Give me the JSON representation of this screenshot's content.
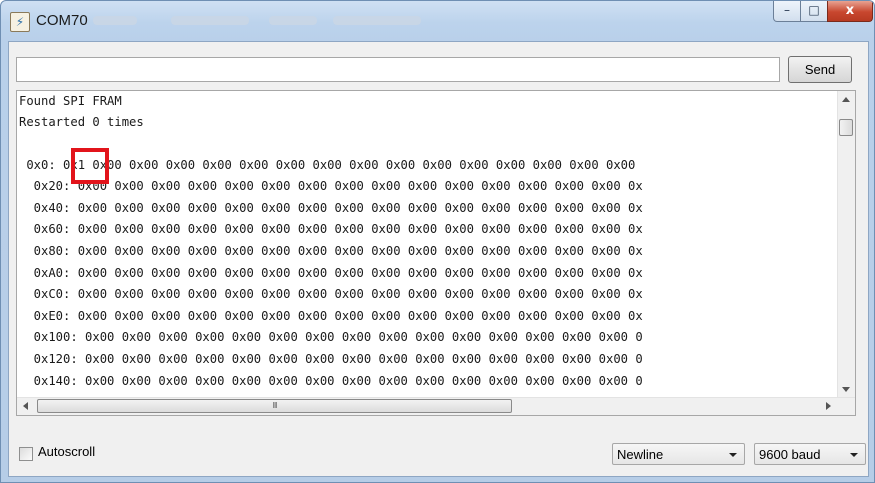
{
  "window": {
    "title": "COM70",
    "close_glyph": "x",
    "min_glyph": "–",
    "max_glyph": "□"
  },
  "toolbar": {
    "send_label": "Send",
    "input_value": ""
  },
  "output": {
    "lines": [
      "Found SPI FRAM",
      "Restarted 0 times",
      "",
      " 0x0: 0x1 0x00 0x00 0x00 0x00 0x00 0x00 0x00 0x00 0x00 0x00 0x00 0x00 0x00 0x00 0x00",
      "  0x20: 0x00 0x00 0x00 0x00 0x00 0x00 0x00 0x00 0x00 0x00 0x00 0x00 0x00 0x00 0x00 0x",
      "  0x40: 0x00 0x00 0x00 0x00 0x00 0x00 0x00 0x00 0x00 0x00 0x00 0x00 0x00 0x00 0x00 0x",
      "  0x60: 0x00 0x00 0x00 0x00 0x00 0x00 0x00 0x00 0x00 0x00 0x00 0x00 0x00 0x00 0x00 0x",
      "  0x80: 0x00 0x00 0x00 0x00 0x00 0x00 0x00 0x00 0x00 0x00 0x00 0x00 0x00 0x00 0x00 0x",
      "  0xA0: 0x00 0x00 0x00 0x00 0x00 0x00 0x00 0x00 0x00 0x00 0x00 0x00 0x00 0x00 0x00 0x",
      "  0xC0: 0x00 0x00 0x00 0x00 0x00 0x00 0x00 0x00 0x00 0x00 0x00 0x00 0x00 0x00 0x00 0x",
      "  0xE0: 0x00 0x00 0x00 0x00 0x00 0x00 0x00 0x00 0x00 0x00 0x00 0x00 0x00 0x00 0x00 0x",
      "  0x100: 0x00 0x00 0x00 0x00 0x00 0x00 0x00 0x00 0x00 0x00 0x00 0x00 0x00 0x00 0x00 0",
      "  0x120: 0x00 0x00 0x00 0x00 0x00 0x00 0x00 0x00 0x00 0x00 0x00 0x00 0x00 0x00 0x00 0",
      "  0x140: 0x00 0x00 0x00 0x00 0x00 0x00 0x00 0x00 0x00 0x00 0x00 0x00 0x00 0x00 0x00 0"
    ],
    "hscroll_grip": "III"
  },
  "bottom": {
    "autoscroll_label": "Autoscroll",
    "autoscroll_checked": false,
    "line_ending_selected": "Newline",
    "baud_selected": "9600 baud"
  },
  "colors": {
    "highlight": "#e2141b",
    "title_bar": "#bcd3ec"
  },
  "icons": {
    "app": "serial-monitor-icon",
    "close": "close-icon",
    "min": "minimize-icon",
    "max": "maximize-icon"
  }
}
